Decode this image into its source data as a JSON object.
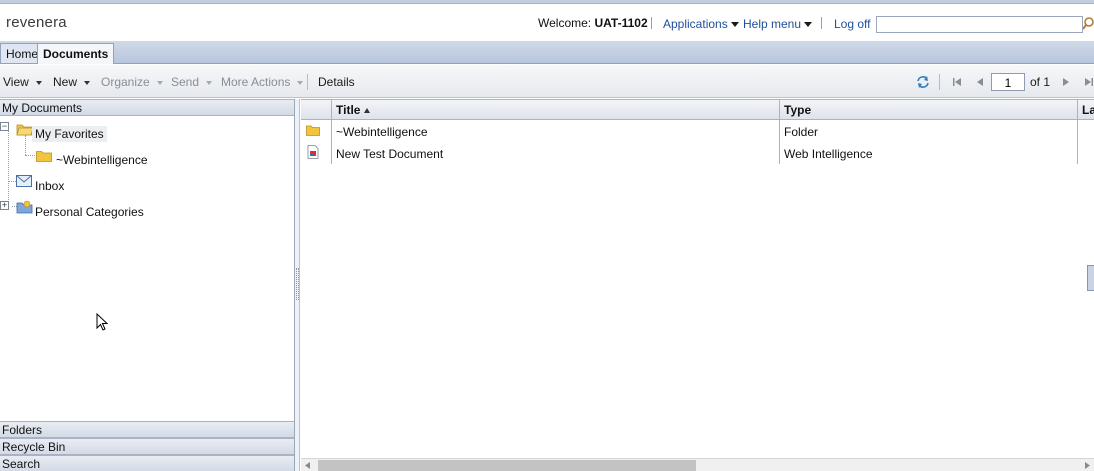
{
  "header": {
    "logo_text": "revenera",
    "welcome_prefix": "Welcome:",
    "username": "UAT-1102",
    "applications_label": "Applications",
    "help_menu_label": "Help menu",
    "logoff_label": "Log off",
    "search_value": ""
  },
  "tabs": [
    {
      "label": "Home",
      "active": false
    },
    {
      "label": "Documents",
      "active": true
    }
  ],
  "toolbar": {
    "view_label": "View",
    "new_label": "New",
    "organize_label": "Organize",
    "send_label": "Send",
    "more_actions_label": "More Actions",
    "details_label": "Details",
    "page_value": "1",
    "page_of": "of 1"
  },
  "left_panel": {
    "header": "My Documents",
    "tree": {
      "favorites": "My Favorites",
      "webintelligence": "~Webintelligence",
      "inbox": "Inbox",
      "personal_categories": "Personal Categories"
    },
    "bottom_sections": [
      "Folders",
      "Recycle Bin",
      "Search"
    ]
  },
  "grid": {
    "columns": [
      "Title",
      "Type",
      "La"
    ],
    "rows": [
      {
        "title": "~Webintelligence",
        "type": "Folder",
        "icon": "folder-icon"
      },
      {
        "title": "New Test Document",
        "type": "Web Intelligence",
        "icon": "webi-document-icon"
      }
    ]
  },
  "colors": {
    "link": "#1f4f9c",
    "tabbar": "#b8c6dc",
    "folder": "#f2c53d"
  }
}
